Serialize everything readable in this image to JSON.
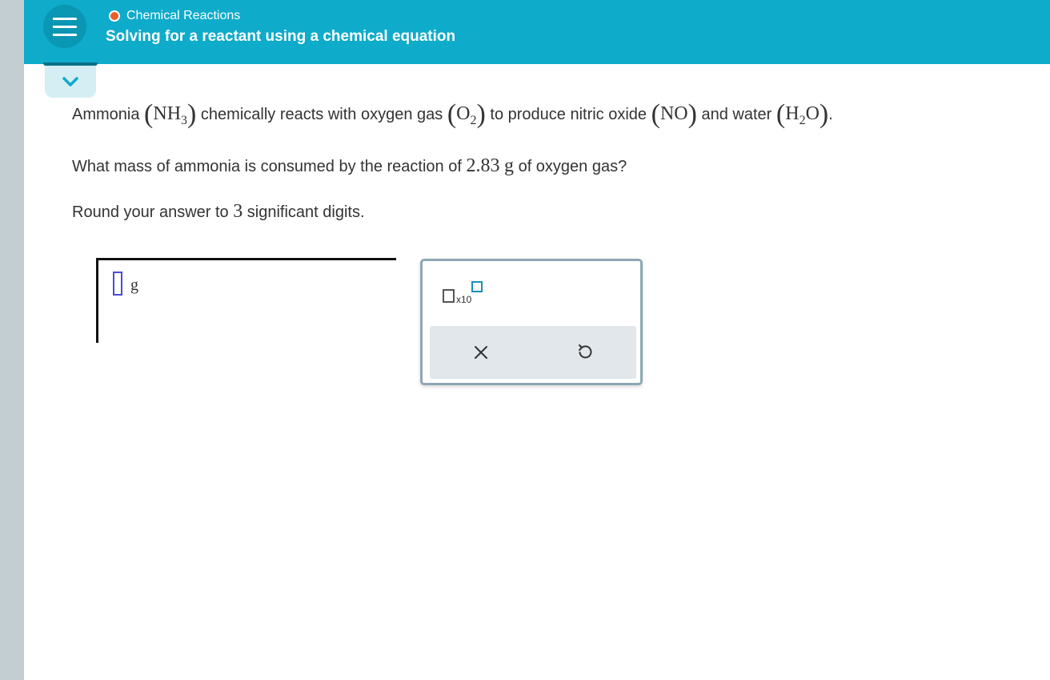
{
  "header": {
    "topic": "Chemical Reactions",
    "title": "Solving for a reactant using a chemical equation"
  },
  "problem": {
    "line1": {
      "t1": "Ammonia ",
      "nh3_main": "NH",
      "nh3_sub": "3",
      "t2": " chemically reacts with oxygen gas ",
      "o2_main": "O",
      "o2_sub": "2",
      "t3": " to produce nitric oxide ",
      "no": "NO",
      "t4": " and water ",
      "h2o_h": "H",
      "h2o_sub": "2",
      "h2o_o": "O",
      "t5": "."
    },
    "line2": {
      "t1": "What mass of ammonia is consumed by the reaction of ",
      "value": "2.83",
      "unit": "g",
      "t2": " of oxygen gas?"
    },
    "line3": {
      "t1": "Round your answer to ",
      "digits": "3",
      "t2": " significant digits."
    }
  },
  "answer": {
    "value": "",
    "unit": "g"
  },
  "palette": {
    "sci_label": "x10",
    "clear_symbol": "×",
    "undo_icon": "undo-icon"
  },
  "colors": {
    "header_bg": "#0eabcb",
    "status_dot": "#f05a28",
    "left_rail": "#c3ced3",
    "palette_border": "#8ea7b5",
    "input_border": "#4a4ae0"
  }
}
